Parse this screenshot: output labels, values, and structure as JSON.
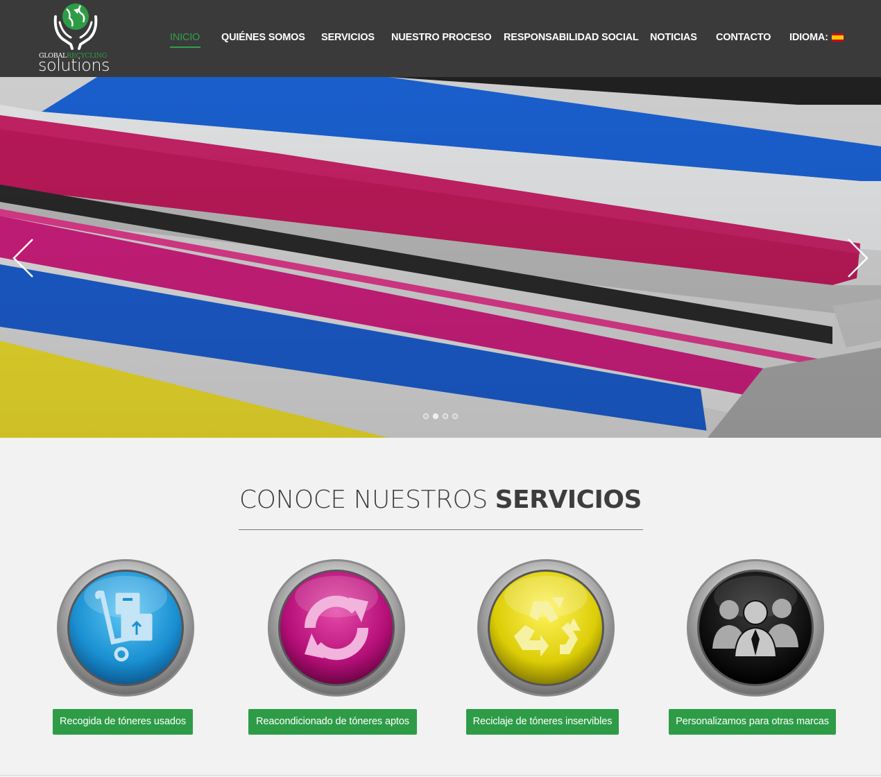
{
  "brand": {
    "logo_top_part1": "GLOBAL",
    "logo_top_part2": "RECYCLING",
    "logo_bottom": "solutions",
    "colors": {
      "green": "#2e9c47",
      "header_bg": "#3a3a3a"
    }
  },
  "nav": {
    "items": [
      {
        "label": "INICIO",
        "active": true
      },
      {
        "label": "QUIÉNES SOMOS"
      },
      {
        "label": "SERVICIOS"
      },
      {
        "label": "NUESTRO PROCESO"
      },
      {
        "label": "RESPONSABILIDAD SOCIAL"
      },
      {
        "label": "NOTICIAS"
      },
      {
        "label": "CONTACTO"
      },
      {
        "label": "IDIOMA:"
      }
    ],
    "language_flag": "spain-flag-icon"
  },
  "slider": {
    "slide_count": 4,
    "active_index": 1,
    "prev_icon": "chevron-left-icon",
    "next_icon": "chevron-right-icon"
  },
  "services": {
    "title_light": "CONOCE NUESTROS",
    "title_bold": "SERVICIOS",
    "items": [
      {
        "label": "Recogida de tóneres usados",
        "icon": "hand-truck-icon",
        "color": "#1f8fd0"
      },
      {
        "label": "Reacondicionado de tóneres aptos",
        "icon": "refresh-icon",
        "color": "#c8127a"
      },
      {
        "label": "Reciclaje de tóneres inservibles",
        "icon": "recycle-icon",
        "color": "#e6d800"
      },
      {
        "label": "Personalizamos para otras marcas",
        "icon": "people-group-icon",
        "color": "#111111"
      }
    ]
  }
}
